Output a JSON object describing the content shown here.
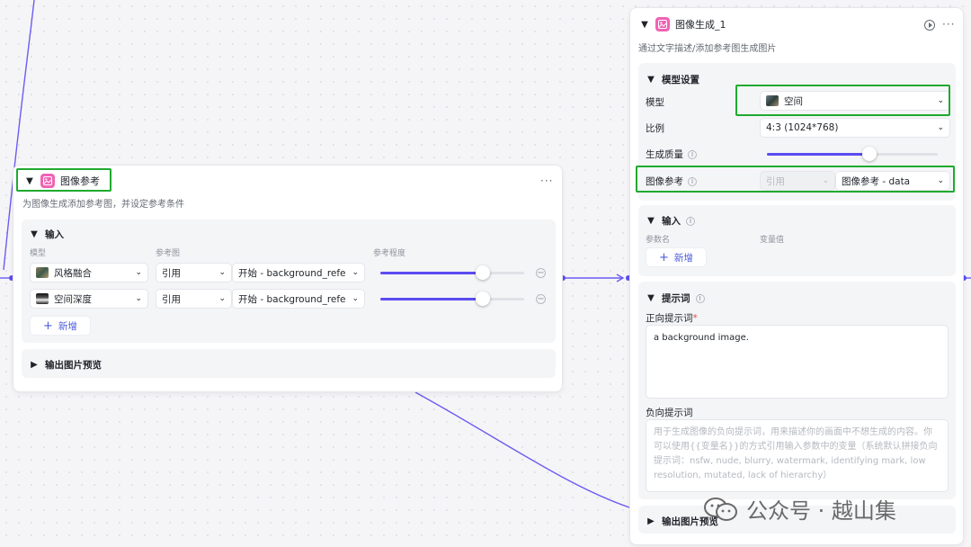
{
  "colors": {
    "accent": "#5b4cf0",
    "highlight": "#1faa2f",
    "node_icon": "#f063b4",
    "link": "#4c5bd9"
  },
  "image_ref_node": {
    "title": "图像参考",
    "description": "为图像生成添加参考图，并设定参考条件",
    "more": "···",
    "input_section": {
      "title": "输入",
      "col_model": "模型",
      "col_ref_image": "参考图",
      "col_degree": "参考程度",
      "rows": [
        {
          "model": "风格融合",
          "mode": "引用",
          "ref": "开始 - background_reference",
          "degree": 0.71,
          "icon": "image-thumb"
        },
        {
          "model": "空间深度",
          "mode": "引用",
          "ref": "开始 - background_reference",
          "degree": 0.71,
          "icon": "image-thumb"
        }
      ],
      "add_label": "新增"
    },
    "output_preview": "输出图片预览"
  },
  "image_gen_node": {
    "title": "图像生成_1",
    "description": "通过文字描述/添加参考图生成图片",
    "more": "···",
    "model_settings": {
      "title": "模型设置",
      "model_label": "模型",
      "model_value": "空间",
      "ratio_label": "比例",
      "ratio_value": "4:3 (1024*768)",
      "quality_label": "生成质量",
      "quality_level": 0.6,
      "image_ref_label": "图像参考",
      "image_ref_mode": "引用",
      "image_ref_value": "图像参考 - data"
    },
    "input_section": {
      "title": "输入",
      "col_param": "参数名",
      "col_value": "变量值",
      "add_label": "新增"
    },
    "prompt_section": {
      "title": "提示词",
      "positive_label": "正向提示词",
      "positive_required": "*",
      "positive_value": "a background image.",
      "negative_label": "负向提示词",
      "negative_placeholder": "用于生成图像的负向提示词，用来描述你的画面中不想生成的内容。你可以使用{{变量名}}的方式引用输入参数中的变量（系统默认拼接负向提示词：nsfw, nude, blurry, watermark, identifying mark, low resolution, mutated, lack of hierarchy）"
    },
    "output_preview": "输出图片预览"
  },
  "watermark": {
    "text": "公众号 · 越山集"
  }
}
